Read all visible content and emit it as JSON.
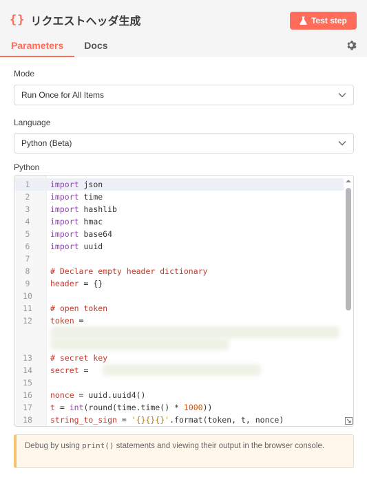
{
  "header": {
    "icon": "curly-braces-icon",
    "title": "リクエストヘッダ生成",
    "test_button": "Test step",
    "tabs": [
      {
        "label": "Parameters",
        "active": true
      },
      {
        "label": "Docs",
        "active": false
      }
    ],
    "accent": "#ff6d5a"
  },
  "mode": {
    "label": "Mode",
    "value": "Run Once for All Items"
  },
  "language": {
    "label": "Language",
    "value": "Python (Beta)"
  },
  "code": {
    "label": "Python",
    "lines": [
      {
        "n": "1",
        "kw": "import",
        "rest": " json"
      },
      {
        "n": "2",
        "kw": "import",
        "rest": " time"
      },
      {
        "n": "3",
        "kw": "import",
        "rest": " hashlib"
      },
      {
        "n": "4",
        "kw": "import",
        "rest": " hmac"
      },
      {
        "n": "5",
        "kw": "import",
        "rest": " base64"
      },
      {
        "n": "6",
        "kw": "import",
        "rest": " uuid"
      },
      {
        "n": "7"
      },
      {
        "n": "8",
        "comment": "# Declare empty header dictionary"
      },
      {
        "n": "9",
        "a": "header",
        "b": " = {}"
      },
      {
        "n": "10"
      },
      {
        "n": "11",
        "comment": "# open token"
      },
      {
        "n": "12",
        "a": "token",
        "b": " ="
      },
      {
        "n": "13",
        "comment": "# secret key"
      },
      {
        "n": "14",
        "a": "secret",
        "b": " ="
      },
      {
        "n": "15"
      },
      {
        "n": "16",
        "a": "nonce",
        "b": " = uuid.uuid4()"
      },
      {
        "n": "17",
        "a": "t",
        "b": " = ",
        "c": "int",
        "d": "(round(time.time() * ",
        "num": "1000",
        "e": "))"
      },
      {
        "n": "18",
        "a": "string_to_sign",
        "b": " = ",
        "str": "'{}{}{}'",
        "e": ".format(token, t, nonce)"
      }
    ]
  },
  "notice": {
    "pre": "Debug by using ",
    "code": "print()",
    "post": " statements and viewing their output in the browser console.",
    "border_color": "#f5c36b"
  }
}
